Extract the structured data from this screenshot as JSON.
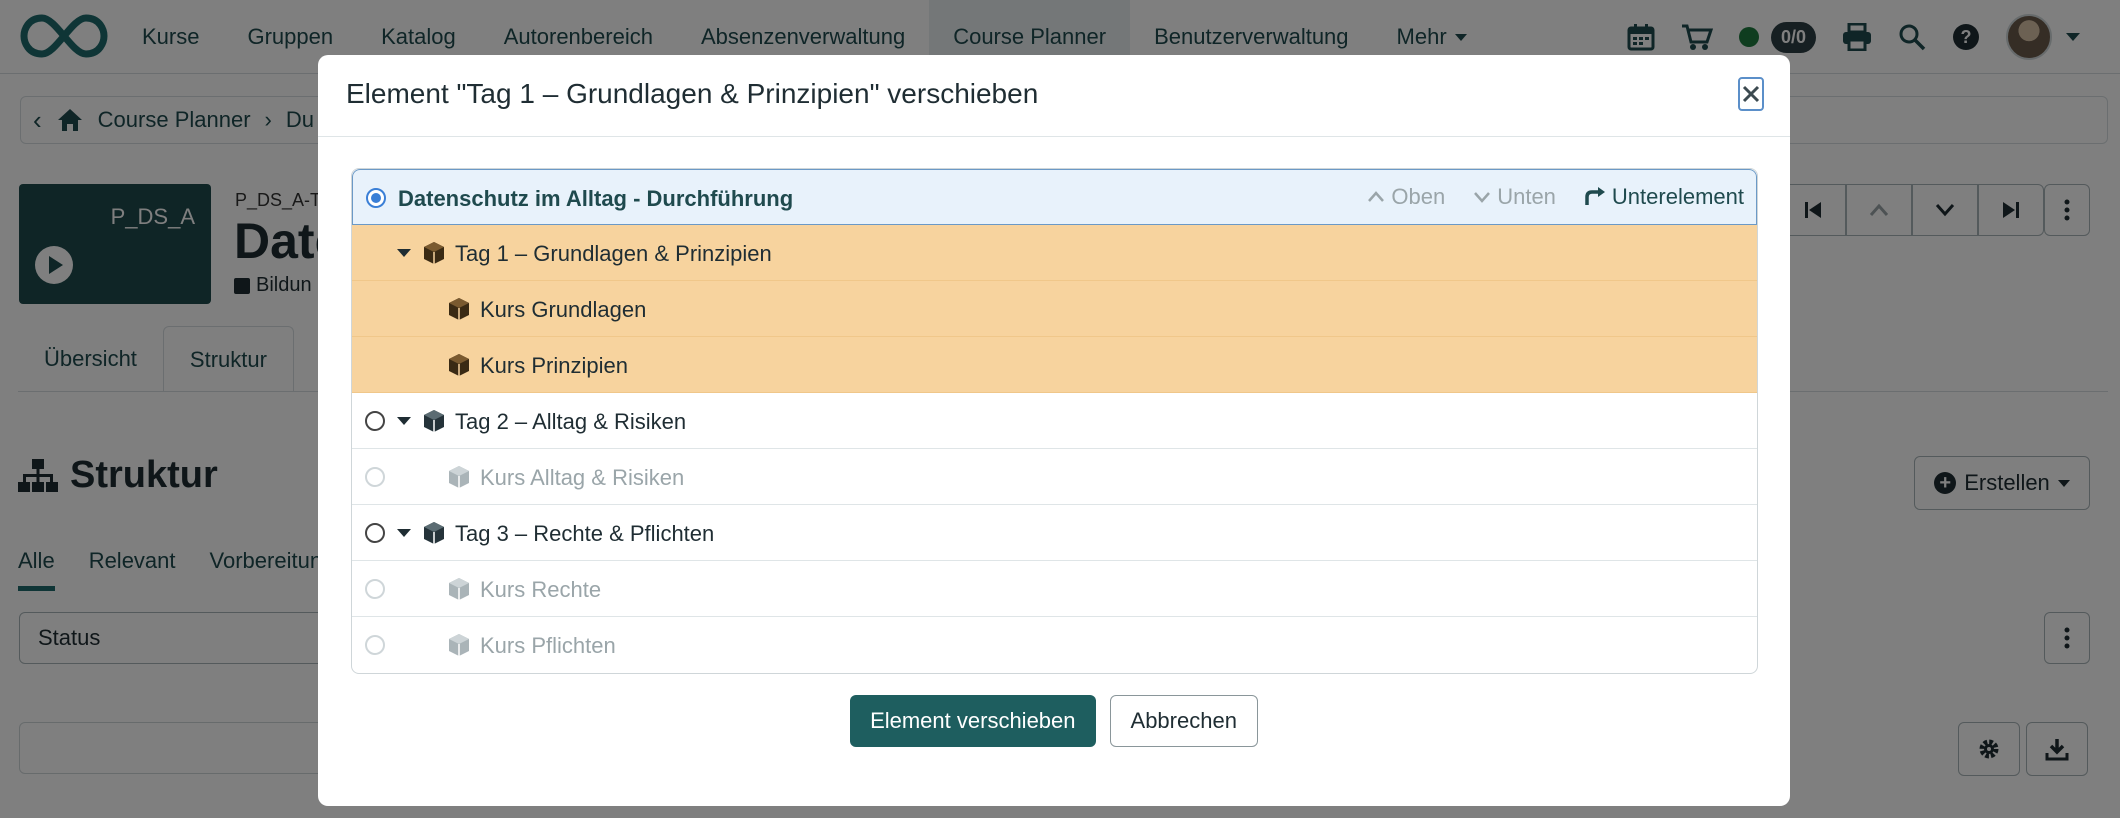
{
  "topnav": {
    "items": [
      {
        "label": "Kurse"
      },
      {
        "label": "Gruppen"
      },
      {
        "label": "Katalog"
      },
      {
        "label": "Autorenbereich"
      },
      {
        "label": "Absenzenverwaltung"
      },
      {
        "label": "Course Planner",
        "active": true
      },
      {
        "label": "Benutzerverwaltung"
      },
      {
        "label": "Mehr"
      }
    ],
    "cart_count": "0/0",
    "brand_color": "#1e5e5f"
  },
  "breadcrumb": {
    "home_label": "Course Planner",
    "current_partial": "Du"
  },
  "course": {
    "code": "P_DS_A",
    "subtitle_partial": "P_DS_A-T",
    "title_partial": "Date",
    "category_partial": "Bildun"
  },
  "tabs": [
    {
      "label": "Übersicht"
    },
    {
      "label": "Struktur",
      "active": true
    }
  ],
  "section": {
    "title": "Struktur",
    "create_label": "Erstellen"
  },
  "filter_tabs": [
    {
      "label": "Alle",
      "active": true
    },
    {
      "label": "Relevant"
    },
    {
      "label": "Vorbereitun"
    }
  ],
  "status_filter": {
    "label": "Status"
  },
  "modal": {
    "title": "Element \"Tag 1 – Grundlagen & Prinzipien\" verschieben",
    "tree": {
      "root": {
        "label": "Datenschutz im Alltag - Durchführung",
        "actions": {
          "up": "Oben",
          "down": "Unten",
          "child": "Unterelement"
        }
      },
      "rows": [
        {
          "label": "Tag 1 – Grundlagen & Prinzipien",
          "state": "moving",
          "level": 1
        },
        {
          "label": "Kurs Grundlagen",
          "state": "moving",
          "level": 2
        },
        {
          "label": "Kurs Prinzipien",
          "state": "moving",
          "level": 2
        },
        {
          "label": "Tag 2 – Alltag & Risiken",
          "state": "selectable",
          "level": 1
        },
        {
          "label": "Kurs Alltag & Risiken",
          "state": "disabled",
          "level": 2
        },
        {
          "label": "Tag 3 – Rechte & Pflichten",
          "state": "selectable",
          "level": 1
        },
        {
          "label": "Kurs Rechte",
          "state": "disabled",
          "level": 2
        },
        {
          "label": "Kurs Pflichten",
          "state": "disabled",
          "level": 2
        }
      ]
    },
    "buttons": {
      "confirm": "Element verschieben",
      "cancel": "Abbrechen"
    },
    "colors": {
      "moving_highlight": "#f7d39e",
      "selected_root": "#e8f2fb",
      "primary_button": "#1e5e5f"
    }
  }
}
